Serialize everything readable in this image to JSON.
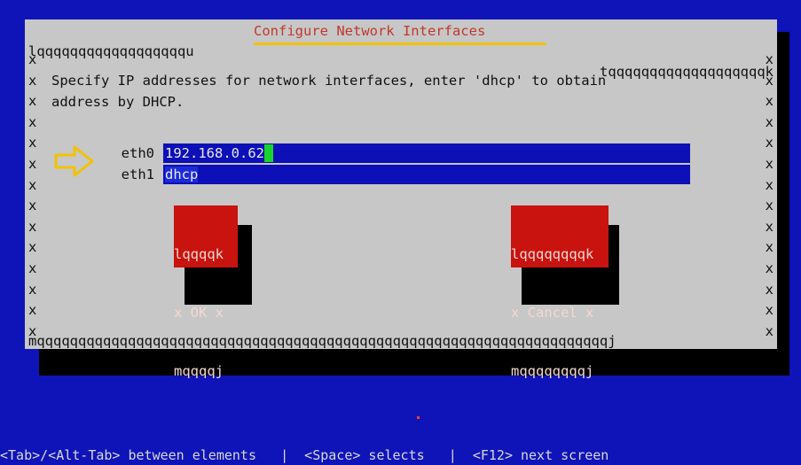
{
  "dialog": {
    "top_left_border": "lqqqqqqqqqqqqqqqqqqu",
    "title": "Configure Network Interfaces",
    "top_right_border": "tqqqqqqqqqqqqqqqqqqqk",
    "side_char": "x",
    "description_line1": "Specify IP addresses for network interfaces, enter 'dhcp' to obtain",
    "description_line2": "address by DHCP.",
    "bottom_border": "mqqqqqqqqqqqqqqqqqqqqqqqqqqqqqqqqqqqqqqqqqqqqqqqqqqqqqqqqqqqqqqqqqqqqqj"
  },
  "interfaces": [
    {
      "label": "eth0",
      "value": "192.168.0.62"
    },
    {
      "label": "eth1",
      "value": "dhcp"
    }
  ],
  "buttons": {
    "ok": {
      "top": "lqqqqk",
      "label": "x OK x",
      "bottom": "mqqqqj"
    },
    "cancel": {
      "top": "lqqqqqqqqk",
      "label": "x Cancel x",
      "bottom": "mqqqqqqqqj"
    }
  },
  "statusbar": {
    "text": "<Tab>/<Alt-Tab> between elements   |  <Space> selects   |  <F12> next screen"
  },
  "colors": {
    "background": "#0f14b8",
    "dialog": "#c7c7c7",
    "button": "#c8130f",
    "cursor": "#19d22c",
    "annotation": "#f2c200",
    "title": "#c0392b"
  },
  "icons": {
    "annotation_arrow": "right-arrow-icon"
  }
}
